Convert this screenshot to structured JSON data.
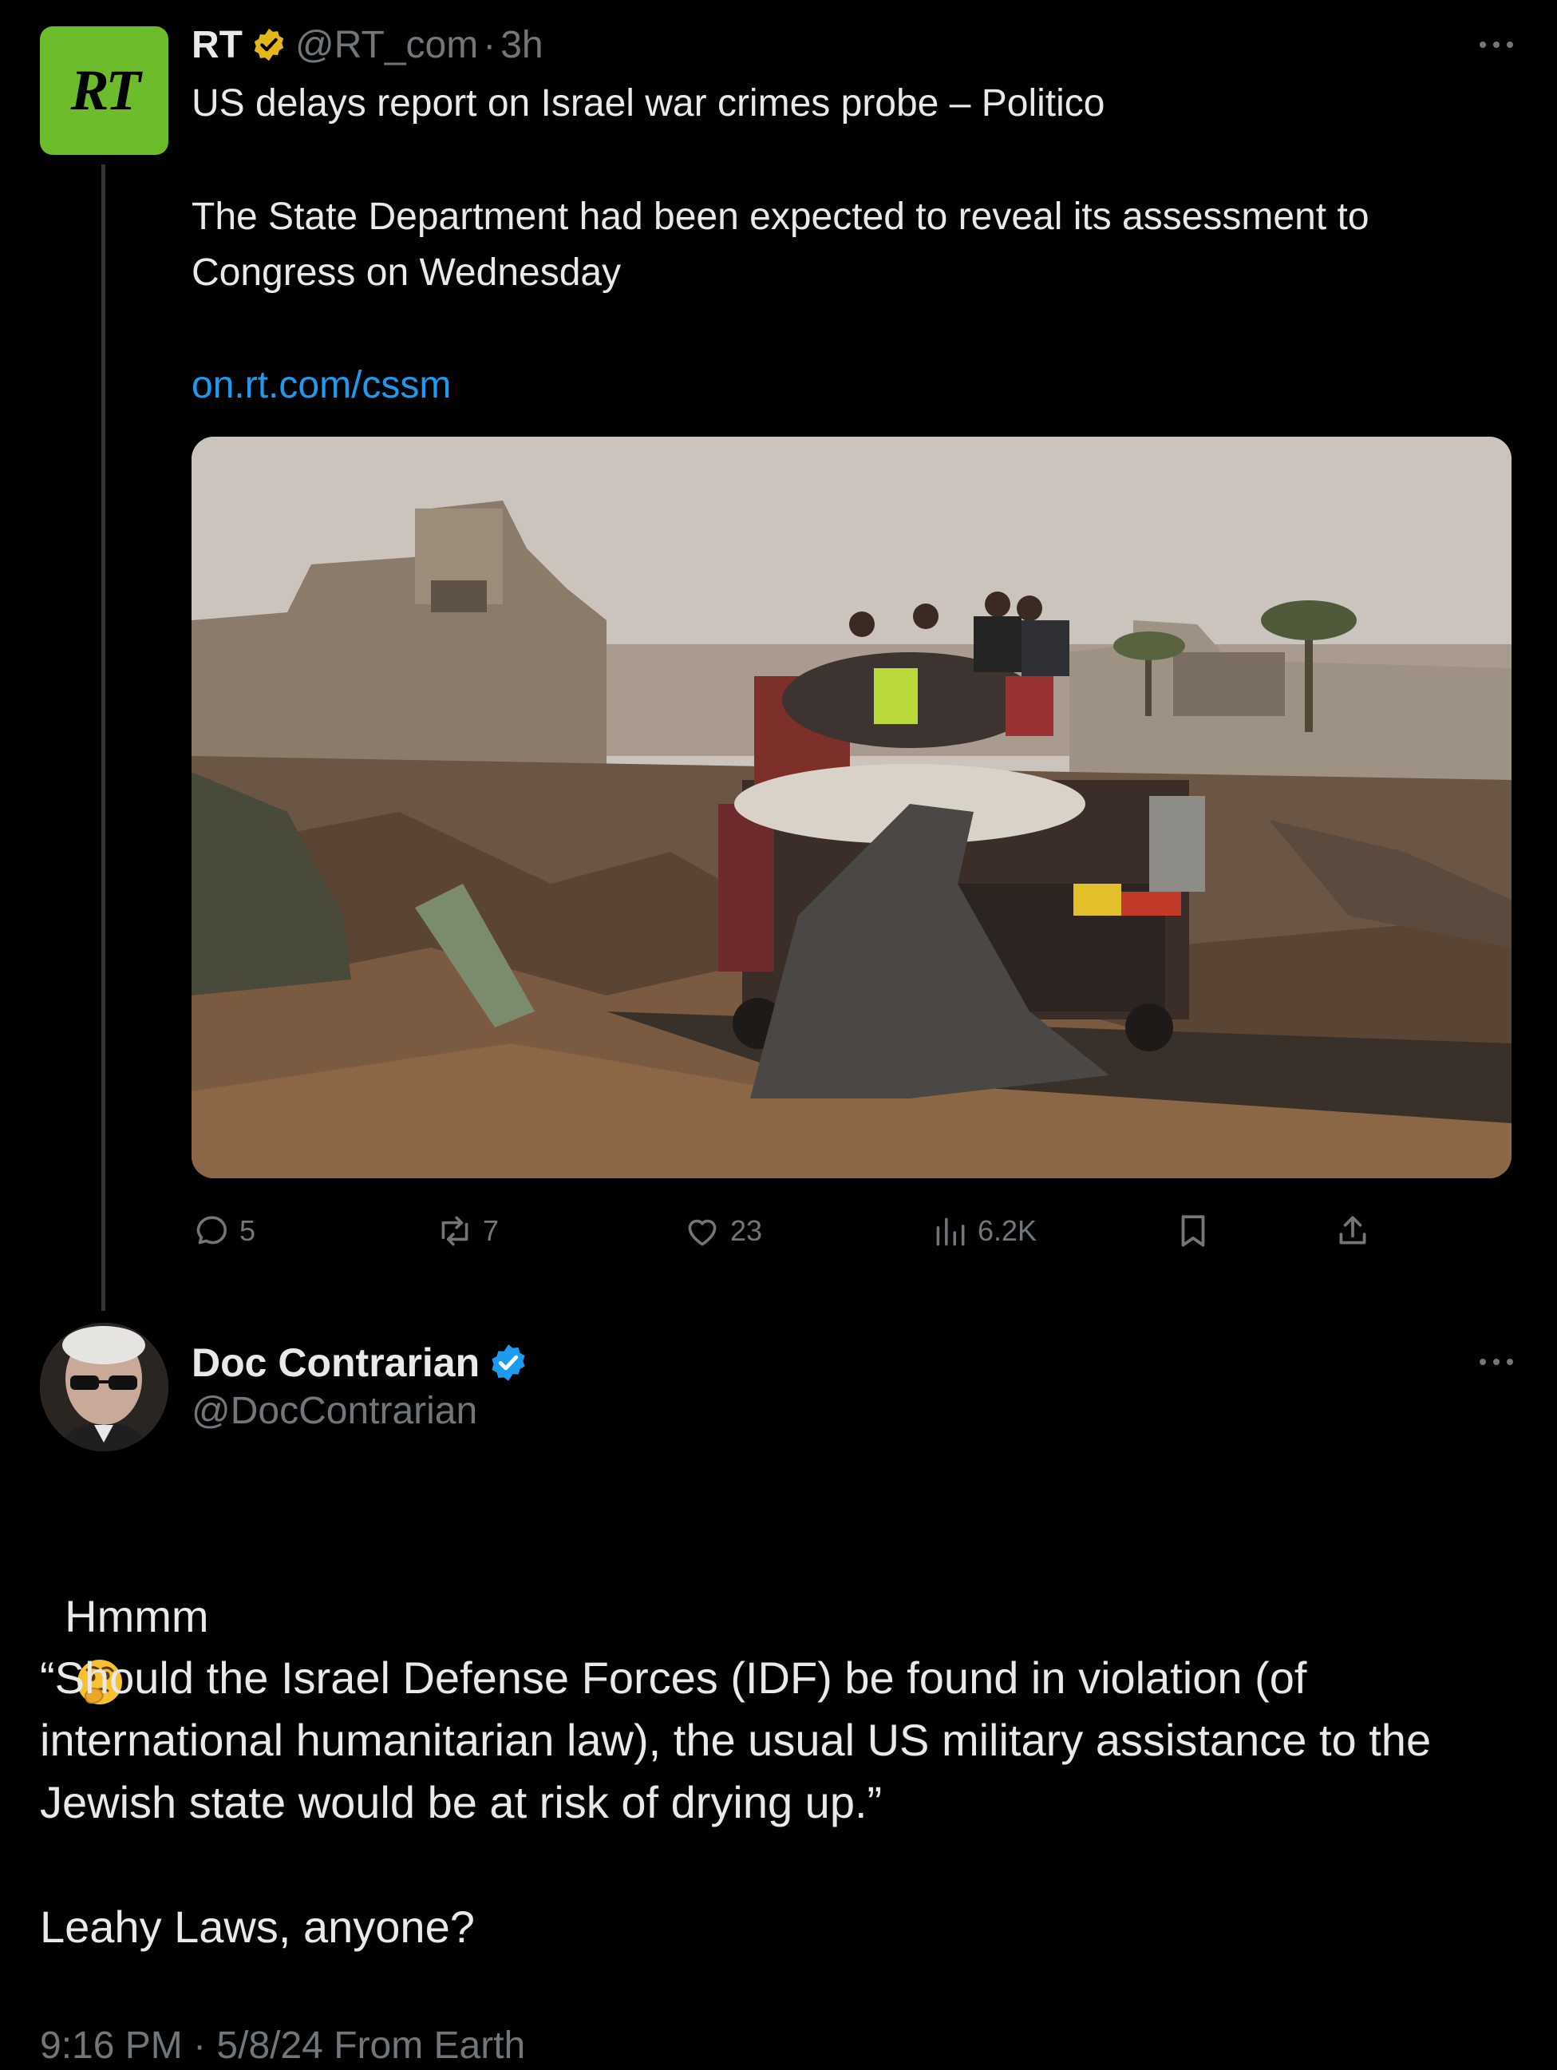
{
  "tweet": {
    "author_name": "RT",
    "handle": "@RT_com",
    "separator": "·",
    "time": "3h",
    "avatar_text": "RT",
    "headline": "US delays report on Israel war crimes probe – Politico",
    "body": "The State Department had been expected to reveal its assessment to\nCongress on Wednesday",
    "link": "on.rt.com/cssm",
    "stats": {
      "replies": "5",
      "reposts": "7",
      "likes": "23",
      "views": "6.2K"
    }
  },
  "reply": {
    "author_name": "Doc Contrarian",
    "handle": "@DocContrarian",
    "line1": "Hmmm",
    "quote": "“Should the Israel Defense Forces (IDF) be found in violation (of\ninternational humanitarian law), the usual US military assistance to the\nJewish state would be at risk of drying up.”",
    "line3": "Leahy Laws, anyone?",
    "timestamp": "9:16 PM · 5/8/24 From Earth"
  },
  "colors": {
    "background": "#000000",
    "text": "#e7e9ea",
    "muted": "#71767b",
    "link": "#1d9bf0",
    "gold_badge": "#e2b719",
    "blue_badge": "#1d9bf0",
    "rt_green": "#6cbc2c"
  },
  "icons": [
    "gold-verified-icon",
    "blue-verified-icon",
    "more-icon",
    "reply-icon",
    "repost-icon",
    "like-icon",
    "views-icon",
    "bookmark-icon",
    "share-icon",
    "thinking-face-emoji"
  ]
}
